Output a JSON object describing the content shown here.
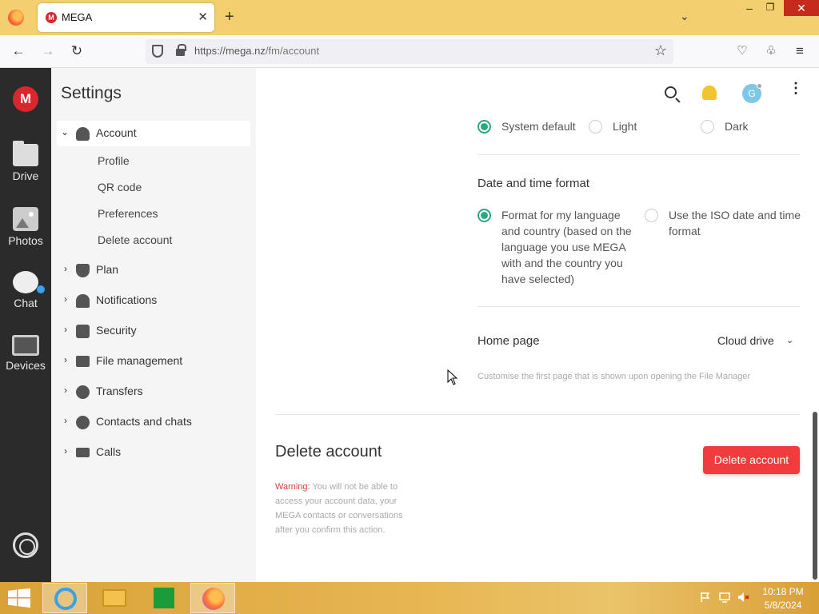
{
  "browser": {
    "tab_title": "MEGA",
    "tab_favicon": "M",
    "tab_close": "✕",
    "new_tab": "+",
    "url_host": "https://mega.nz",
    "url_path": "/fm/account",
    "controls": {
      "minimize": "–",
      "maximize": "❐",
      "close": "✕"
    }
  },
  "rail": {
    "logo": "M",
    "items": [
      {
        "label": "Drive",
        "icon": "folder-icon"
      },
      {
        "label": "Photos",
        "icon": "photo-icon"
      },
      {
        "label": "Chat",
        "icon": "chat-icon"
      },
      {
        "label": "Devices",
        "icon": "devices-icon"
      }
    ]
  },
  "sidebar": {
    "title": "Settings",
    "account": {
      "label": "Account",
      "expanded": true,
      "subitems": [
        "Profile",
        "QR code",
        "Preferences",
        "Delete account"
      ]
    },
    "sections": [
      {
        "label": "Plan",
        "icon": "shield-icon"
      },
      {
        "label": "Notifications",
        "icon": "megaphone-icon"
      },
      {
        "label": "Security",
        "icon": "lock-icon"
      },
      {
        "label": "File management",
        "icon": "folder-icon"
      },
      {
        "label": "Transfers",
        "icon": "transfer-icon"
      },
      {
        "label": "Contacts and chats",
        "icon": "chat-bubble-icon"
      },
      {
        "label": "Calls",
        "icon": "video-icon"
      }
    ]
  },
  "header": {
    "avatar_initial": "G"
  },
  "theme": {
    "options": [
      {
        "label": "System default",
        "selected": true
      },
      {
        "label": "Light",
        "selected": false
      },
      {
        "label": "Dark",
        "selected": false
      }
    ]
  },
  "date_time": {
    "title": "Date and time format",
    "option_language": "Format for my language and country (based on the language you use MEGA with and the country you have selected)",
    "option_iso": "Use the ISO date and time format",
    "selected": "language"
  },
  "home_page": {
    "title": "Home page",
    "value": "Cloud drive",
    "description": "Customise the first page that is shown upon opening the File Manager"
  },
  "delete_account": {
    "title": "Delete account",
    "button": "Delete account",
    "warning_label": "Warning:",
    "warning_text": " You will not be able to access your account data, your MEGA contacts or conversations after you confirm this action."
  },
  "taskbar": {
    "time": "10:18 PM",
    "date": "5/8/2024"
  },
  "colors": {
    "accent_green": "#2ba97e",
    "danger_red": "#f03c3c",
    "mega_red": "#d9272e",
    "taskbar": "#e0ad45"
  }
}
